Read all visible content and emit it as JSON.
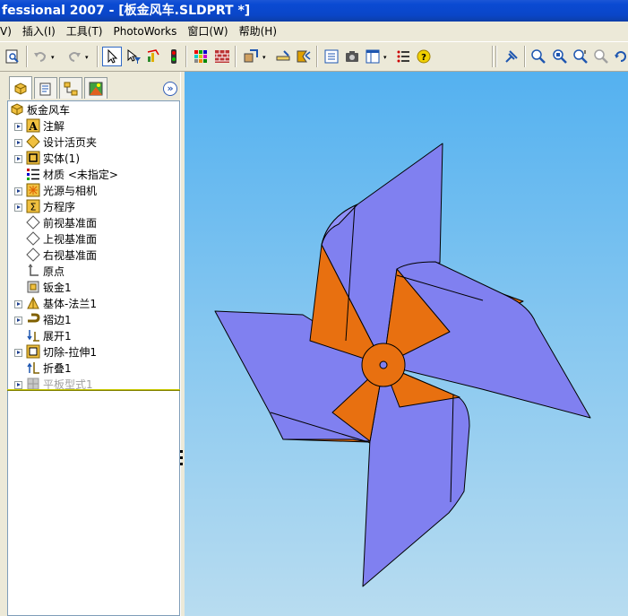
{
  "window": {
    "title": "fessional 2007 - [板金风车.SLDPRT *]"
  },
  "menu": {
    "items": [
      {
        "label": "V)"
      },
      {
        "label": "插入(I)"
      },
      {
        "label": "工具(T)"
      },
      {
        "label": "PhotoWorks"
      },
      {
        "label": "窗口(W)"
      },
      {
        "label": "帮助(H)"
      }
    ]
  },
  "toolbar": {
    "buttons": [
      {
        "name": "print-preview-icon"
      },
      {
        "name": "undo-icon"
      },
      {
        "name": "redo-icon"
      },
      {
        "name": "select-arrow-icon"
      },
      {
        "name": "select-filter-icon"
      },
      {
        "name": "rebuild-icon"
      },
      {
        "name": "traffic-light-icon"
      },
      {
        "name": "options-grid-icon"
      },
      {
        "name": "brick-wall-icon"
      },
      {
        "name": "appearance-icon"
      },
      {
        "name": "measure-icon"
      },
      {
        "name": "mass-properties-icon"
      },
      {
        "name": "properties-list-icon"
      },
      {
        "name": "camera-icon"
      },
      {
        "name": "window-layout-icon"
      },
      {
        "name": "bulleted-list-icon"
      },
      {
        "name": "help-icon"
      },
      {
        "name": "pin-icon"
      },
      {
        "name": "zoom-to-fit-icon"
      },
      {
        "name": "zoom-area-icon"
      },
      {
        "name": "zoom-in-out-icon"
      },
      {
        "name": "zoom-selection-icon"
      },
      {
        "name": "rotate-view-icon"
      }
    ]
  },
  "panel": {
    "tabs": [
      {
        "name": "feature-manager-tab"
      },
      {
        "name": "property-manager-tab"
      },
      {
        "name": "configuration-manager-tab"
      },
      {
        "name": "display-manager-tab"
      }
    ],
    "expander_label": "»"
  },
  "tree": {
    "root": {
      "label": "板金风车"
    },
    "items": [
      {
        "label": "注解",
        "expandable": true,
        "icon": "annotations-icon"
      },
      {
        "label": "设计活页夹",
        "expandable": true,
        "icon": "design-binder-icon"
      },
      {
        "label": "实体(1)",
        "expandable": true,
        "icon": "solid-bodies-icon"
      },
      {
        "label": "材质 <未指定>",
        "expandable": false,
        "icon": "material-icon"
      },
      {
        "label": "光源与相机",
        "expandable": true,
        "icon": "lights-cameras-icon"
      },
      {
        "label": "方程序",
        "expandable": true,
        "icon": "equations-icon"
      },
      {
        "label": "前视基准面",
        "expandable": false,
        "icon": "plane-icon"
      },
      {
        "label": "上视基准面",
        "expandable": false,
        "icon": "plane-icon"
      },
      {
        "label": "右视基准面",
        "expandable": false,
        "icon": "plane-icon"
      },
      {
        "label": "原点",
        "expandable": false,
        "icon": "origin-icon"
      },
      {
        "label": "钣金1",
        "expandable": false,
        "icon": "sheet-metal-icon"
      },
      {
        "label": "基体-法兰1",
        "expandable": true,
        "icon": "base-flange-icon"
      },
      {
        "label": "褶边1",
        "expandable": true,
        "icon": "hem-icon"
      },
      {
        "label": "展开1",
        "expandable": false,
        "icon": "unfold-icon"
      },
      {
        "label": "切除-拉伸1",
        "expandable": true,
        "icon": "cut-extrude-icon"
      },
      {
        "label": "折叠1",
        "expandable": false,
        "icon": "fold-icon"
      },
      {
        "label": "平板型式1",
        "expandable": true,
        "icon": "flat-pattern-icon",
        "suppressed": true
      }
    ]
  },
  "colors": {
    "blade_face": "#8080f0",
    "blade_fold": "#e87010",
    "viewport_top": "#54b1f0",
    "viewport_bottom": "#b8dcf0"
  }
}
